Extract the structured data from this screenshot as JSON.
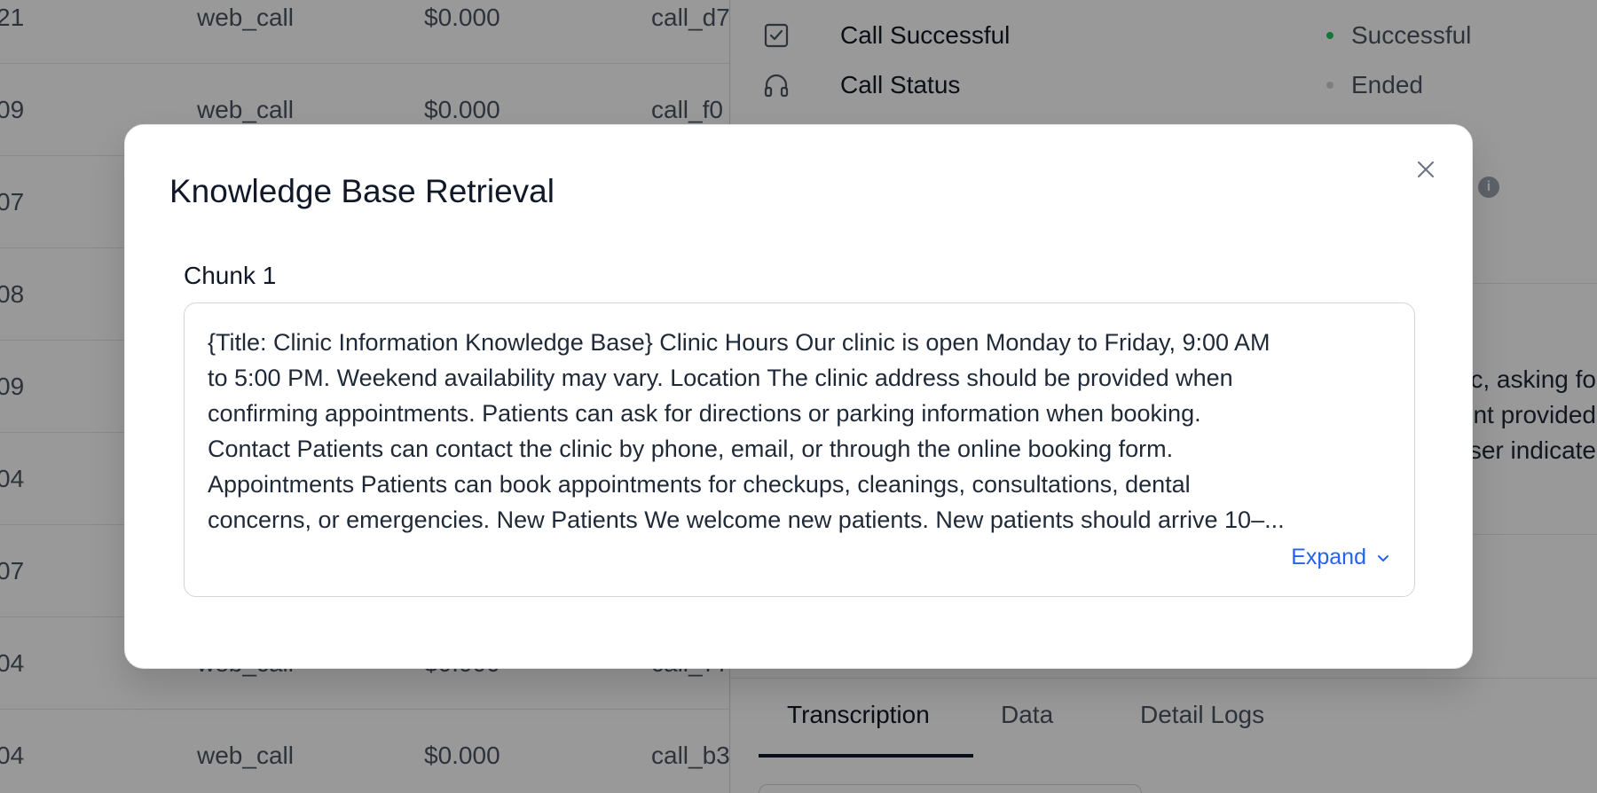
{
  "table": {
    "rows": [
      {
        "id": "21",
        "type": "web_call",
        "cost": "$0.000",
        "call": "call_d7"
      },
      {
        "id": "09",
        "type": "web_call",
        "cost": "$0.000",
        "call": "call_f0"
      },
      {
        "id": "07",
        "type": "",
        "cost": "",
        "call": ""
      },
      {
        "id": "08",
        "type": "",
        "cost": "",
        "call": ""
      },
      {
        "id": "09",
        "type": "",
        "cost": "",
        "call": ""
      },
      {
        "id": "04",
        "type": "",
        "cost": "",
        "call": ""
      },
      {
        "id": "07",
        "type": "",
        "cost": "",
        "call": ""
      },
      {
        "id": "04",
        "type": "web_call",
        "cost": "$0.000",
        "call": "call_77"
      },
      {
        "id": "04",
        "type": "web_call",
        "cost": "$0.000",
        "call": "call_b3"
      }
    ]
  },
  "detail": {
    "call_successful": {
      "label": "Call Successful",
      "value": "Successful",
      "dot_color": "#22c55e",
      "icon": "checkbox-icon"
    },
    "call_status": {
      "label": "Call Status",
      "value": "Ended",
      "dot_color": "#d1d5db",
      "icon": "headphones-icon"
    },
    "info_icon_glyph": "i",
    "summary_lines": [
      "c, asking fo",
      "nt provided",
      "ser indicate"
    ],
    "tabs": [
      {
        "label": "Transcription"
      },
      {
        "label": "Data"
      },
      {
        "label": "Detail Logs"
      }
    ]
  },
  "modal": {
    "title": "Knowledge Base Retrieval",
    "chunk_label": "Chunk 1",
    "chunk_lines": [
      "{Title: Clinic Information Knowledge Base} Clinic Hours Our clinic is open Monday to Friday, 9:00 AM",
      "to 5:00 PM. Weekend availability may vary. Location The clinic address should be provided when",
      "confirming appointments. Patients can ask for directions or parking information when booking.",
      "Contact Patients can contact the clinic by phone, email, or through the online booking form.",
      "Appointments Patients can book appointments for checkups, cleanings, consultations, dental",
      "concerns, or emergencies. New Patients We welcome new patients. New patients should arrive 10–..."
    ],
    "expand_label": "Expand",
    "accent_color": "#2563eb"
  }
}
